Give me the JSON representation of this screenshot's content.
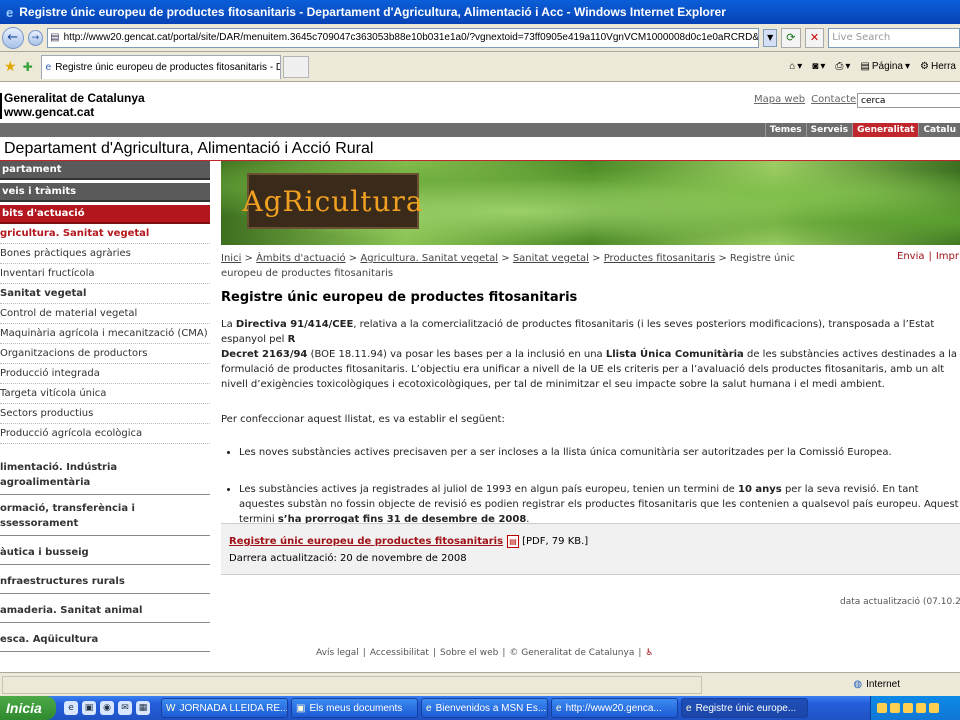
{
  "window": {
    "title": "Registre únic europeu de productes fitosanitaris - Departament d'Agricultura, Alimentació i Acc - Windows Internet Explorer"
  },
  "browser": {
    "url": "http://www20.gencat.cat/portal/site/DAR/menuitem.3645c709047c363053b88e10b031e1a0/?vgnextoid=73ff0905e419a110VgnVCM1000008d0c1e0aRCRD&vgnextchannel=73f",
    "search_placeholder": "Live Search",
    "tab_label": "Registre únic europeu de productes fitosanitaris - Dep...",
    "tools": {
      "page": "Página",
      "tools": "Herra"
    }
  },
  "site": {
    "logo_line1": "Generalitat de Catalunya",
    "logo_line2": "www.gencat.cat",
    "map_link": "Mapa web",
    "contact_link": "Contacte",
    "search_value": "cerca",
    "top_nav": [
      "Temes",
      "Serveis",
      "Generalitat",
      "Catalu"
    ],
    "dept_title": "Departament d'Agricultura, Alimentació i Acció Rural"
  },
  "sidebar": {
    "heads": [
      "partament",
      "veis i tràmits",
      "bits d'actuació"
    ],
    "current": "gricultura. Sanitat vegetal",
    "subs": [
      "Bones pràctiques agràries",
      "Inventari fructícola"
    ],
    "current2": "Sanitat vegetal",
    "subs2": [
      "Control de material vegetal",
      "Maquinària agrícola i mecanització (CMA)",
      "Organitzacions de productors",
      "Producció integrada",
      "Targeta vitícola única",
      "Sectors productius",
      "Producció agrícola ecològica"
    ],
    "cats": [
      "limentació. Indústria agroalimentària",
      "ormació, transferència i\nssessorament",
      "àutica i busseig",
      "nfraestructures rurals",
      "amaderia. Sanitat animal",
      "esca. Aqüicultura"
    ]
  },
  "banner": {
    "logo_text": "AgRicultura"
  },
  "breadcrumb": {
    "items": [
      "Inici",
      "Àmbits d'actuació",
      "Agricultura. Sanitat vegetal",
      "Sanitat vegetal",
      "Productes fitosanitaris"
    ],
    "current": "Registre únic europeu de productes fitosanitaris",
    "send": "Envia",
    "print": "Imprim"
  },
  "article": {
    "title": "Registre únic europeu de productes fitosanitaris",
    "p1_a": "La ",
    "p1_b": "Directiva 91/414/CEE",
    "p1_c": ", relativa a la comercialització de productes fitosanitaris (i les seves posteriors modificacions), transposada a l’Estat espanyol pel ",
    "p1_d": "R",
    "p1_e": "Decret 2163/94",
    "p1_f": " (BOE 18.11.94) va posar les bases per a la inclusió en una ",
    "p1_g": "Llista Única Comunitària",
    "p1_h": " de les substàncies actives destinades a la formulació de productes fitosanitaris. L’objectiu era unificar a nivell de la UE els criteris per a l’avaluació dels productes fitosanitaris, amb un alt nivell d’exigències toxicològiques i ecotoxicològiques, per tal de minimitzar el seu impacte sobre la salut humana i el medi ambient.",
    "p2": "Per confeccionar aquest llistat, es va establir el següent:",
    "li1": "Les noves substàncies actives precisaven per a ser incloses a la llista única comunitària ser autoritzades per la Comissió Europea.",
    "li2_a": "Les substàncies actives ja registrades al juliol de 1993 en algun país europeu, tenien un termini de ",
    "li2_b": "10 anys",
    "li2_c": " per la seva revisió. En tant aquestes substàn no fossin objecte de revisió es podien registrar els productes fitosanitaris que les contenien a qualsevol país europeu. Aquest termini ",
    "li2_d": "s’ha prorrogat fins 31 de desembre de 2008",
    "li2_e": "."
  },
  "download": {
    "link": "Registre únic europeu de productes fitosanitaris",
    "meta": "[PDF, 79 KB.]",
    "updated": "Darrera actualització: 20 de novembre de 2008"
  },
  "date_update": "data actualització (07.10.2",
  "footer": [
    "Avís legal",
    "Accessibilitat",
    "Sobre el web",
    "© Generalitat de Catalunya"
  ],
  "status": {
    "zone": "Internet"
  },
  "taskbar": {
    "start": "Inicia",
    "tasks": [
      "JORNADA LLEIDA RE...",
      "Els meus documents",
      "Bienvenidos a MSN Es...",
      "http://www20.genca...",
      "Registre únic europe..."
    ]
  }
}
